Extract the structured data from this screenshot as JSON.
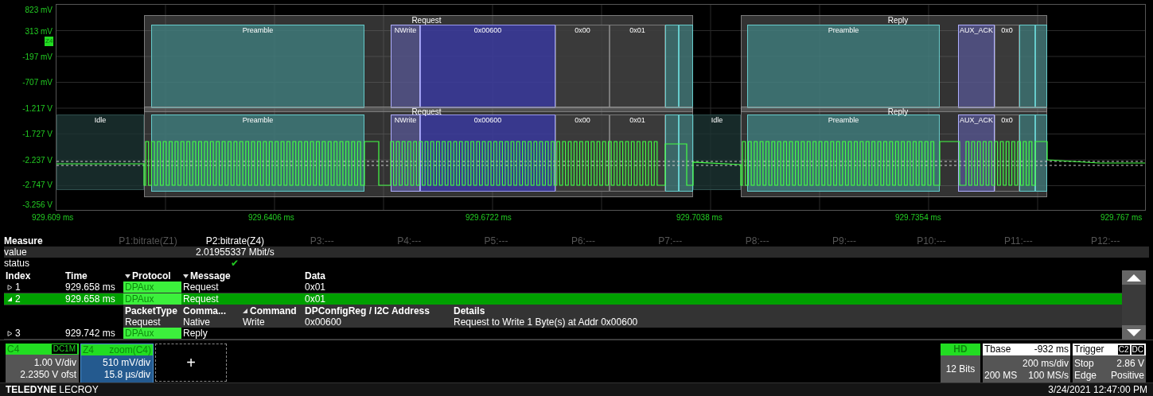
{
  "scope": {
    "y_axis": {
      "labels": [
        "823 mV",
        "313 mV",
        "-197 mV",
        "-707 mV",
        "-1.217 V",
        "-1.727 V",
        "-2.237 V",
        "-2.747 V",
        "-3.256 V"
      ],
      "marker": "Z4"
    },
    "x_axis": {
      "labels": [
        "929.609 ms",
        "929.6406 ms",
        "929.6722 ms",
        "929.7038 ms",
        "929.7354 ms",
        "929.767 ms"
      ]
    },
    "decode_lanes": [
      {
        "segments": [
          {
            "kind": "packet",
            "label": "Request",
            "fields": [
              {
                "kind": "preamble",
                "label": "Preamble"
              },
              {
                "kind": "command",
                "label": "NWrite"
              },
              {
                "kind": "address",
                "label": "0x00600"
              },
              {
                "kind": "data",
                "label": "0x00"
              },
              {
                "kind": "data",
                "label": "0x01"
              }
            ]
          },
          {
            "kind": "packet",
            "label": "Reply",
            "fields": [
              {
                "kind": "preamble",
                "label": "Preamble"
              },
              {
                "kind": "command",
                "label": "AUX_ACK"
              },
              {
                "kind": "data",
                "label": "0x0"
              }
            ]
          }
        ]
      },
      {
        "segments": [
          {
            "kind": "idle",
            "label": "Idle"
          },
          {
            "kind": "packet",
            "label": "Request",
            "fields": [
              {
                "kind": "preamble",
                "label": "Preamble"
              },
              {
                "kind": "command",
                "label": "NWrite"
              },
              {
                "kind": "address",
                "label": "0x00600"
              },
              {
                "kind": "data",
                "label": "0x00"
              },
              {
                "kind": "data",
                "label": "0x01"
              }
            ]
          },
          {
            "kind": "idle",
            "label": "Idle"
          },
          {
            "kind": "packet",
            "label": "Reply",
            "fields": [
              {
                "kind": "preamble",
                "label": "Preamble"
              },
              {
                "kind": "command",
                "label": "AUX_ACK"
              },
              {
                "kind": "data",
                "label": "0x0"
              }
            ]
          }
        ]
      }
    ]
  },
  "measure": {
    "title": "Measure",
    "row_labels": [
      "value",
      "status"
    ],
    "params": [
      {
        "label": "P1:bitrate(Z1)",
        "enabled": false
      },
      {
        "label": "P2:bitrate(Z4)",
        "enabled": true,
        "value": "2.01955337 Mbit/s",
        "status": "✔"
      },
      {
        "label": "P3:---",
        "enabled": false
      },
      {
        "label": "P4:---",
        "enabled": false
      },
      {
        "label": "P5:---",
        "enabled": false
      },
      {
        "label": "P6:---",
        "enabled": false
      },
      {
        "label": "P7:---",
        "enabled": false
      },
      {
        "label": "P8:---",
        "enabled": false
      },
      {
        "label": "P9:---",
        "enabled": false
      },
      {
        "label": "P10:---",
        "enabled": false
      },
      {
        "label": "P11:---",
        "enabled": false
      },
      {
        "label": "P12:---",
        "enabled": false
      }
    ]
  },
  "decode_table": {
    "columns": [
      {
        "label": "Index",
        "sortable": false
      },
      {
        "label": "Time",
        "sortable": false
      },
      {
        "label": "Protocol",
        "sortable": true
      },
      {
        "label": "Message",
        "sortable": true
      },
      {
        "label": "Data",
        "sortable": false
      }
    ],
    "rows": [
      {
        "expanded": false,
        "selected": false,
        "cells": [
          "1",
          "929.658 ms",
          "DPAux",
          "Request",
          "0x01"
        ]
      },
      {
        "expanded": true,
        "selected": true,
        "cells": [
          "2",
          "929.658 ms",
          "DPAux",
          "Request",
          "0x01"
        ],
        "details": {
          "columns": [
            {
              "label": "PacketType",
              "sortable": false
            },
            {
              "label": "Comma...",
              "sortable": false
            },
            {
              "label": "Command",
              "sortable": true
            },
            {
              "label": "DPConfigReg / I2C Address",
              "sortable": false
            },
            {
              "label": "Details",
              "sortable": false
            }
          ],
          "values": [
            "Request",
            "Native",
            "Write",
            "0x00600",
            "Request to Write 1 Byte(s) at Addr 0x00600"
          ]
        }
      },
      {
        "expanded": false,
        "selected": false,
        "cells": [
          "3",
          "929.742 ms",
          "DPAux",
          "Reply"
        ]
      }
    ]
  },
  "descriptors": [
    {
      "kind": "channel",
      "name": "C4",
      "coupling": "DC1M",
      "lines": [
        "1.00 V/div",
        "2.2350 V ofst"
      ]
    },
    {
      "kind": "zoom",
      "name": "Z4",
      "source": "zoom(C4)",
      "lines": [
        "510 mV/div",
        "15.8 µs/div"
      ]
    },
    {
      "kind": "add",
      "label": "+"
    }
  ],
  "acquisition": {
    "hd": {
      "title": "HD",
      "body": "12 Bits"
    },
    "timebase": {
      "title": "Tbase",
      "delay": "-932 ms",
      "per_div": "200 ms/div",
      "samples": "200 MS",
      "rate": "100 MS/s"
    },
    "trigger": {
      "title": "Trigger",
      "source": "C2",
      "coupling": "DC",
      "mode": "Stop",
      "level": "2.86 V",
      "type": "Edge",
      "slope": "Positive"
    }
  },
  "footer": {
    "brand": "**TELEDYNE** LECROY",
    "datetime": "3/24/2021 12:47:00 PM"
  }
}
